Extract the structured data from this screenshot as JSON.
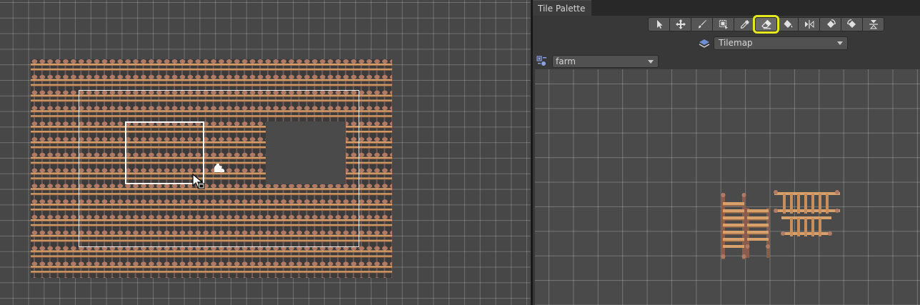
{
  "palette_window": {
    "tab_title": "Tile Palette",
    "tools": [
      {
        "name": "select",
        "icon": "arrow-pointer-icon",
        "active": false
      },
      {
        "name": "move",
        "icon": "move-arrows-icon",
        "active": false
      },
      {
        "name": "paint",
        "icon": "paintbrush-icon",
        "active": false
      },
      {
        "name": "box-fill",
        "icon": "box-fill-icon",
        "active": false
      },
      {
        "name": "pick",
        "icon": "eyedropper-icon",
        "active": false
      },
      {
        "name": "erase",
        "icon": "eraser-icon",
        "active": true
      },
      {
        "name": "fill",
        "icon": "paint-bucket-icon",
        "active": false
      },
      {
        "name": "flip-x",
        "icon": "flip-horizontal-icon",
        "active": false
      },
      {
        "name": "rotate-clockwise",
        "icon": "rotate-clockwise-icon",
        "active": false
      },
      {
        "name": "rotate-counterclockwise",
        "icon": "rotate-counterclockwise-icon",
        "active": false
      },
      {
        "name": "flip-y",
        "icon": "flip-vertical-icon",
        "active": false
      }
    ],
    "active_target": "Tilemap",
    "palette": "farm"
  },
  "colors": {
    "highlight": "#e6ea1c",
    "panel": "#383838",
    "scene_bg": "#474747",
    "fence_wood": "#d8a06a",
    "fence_post": "#b07a65"
  }
}
